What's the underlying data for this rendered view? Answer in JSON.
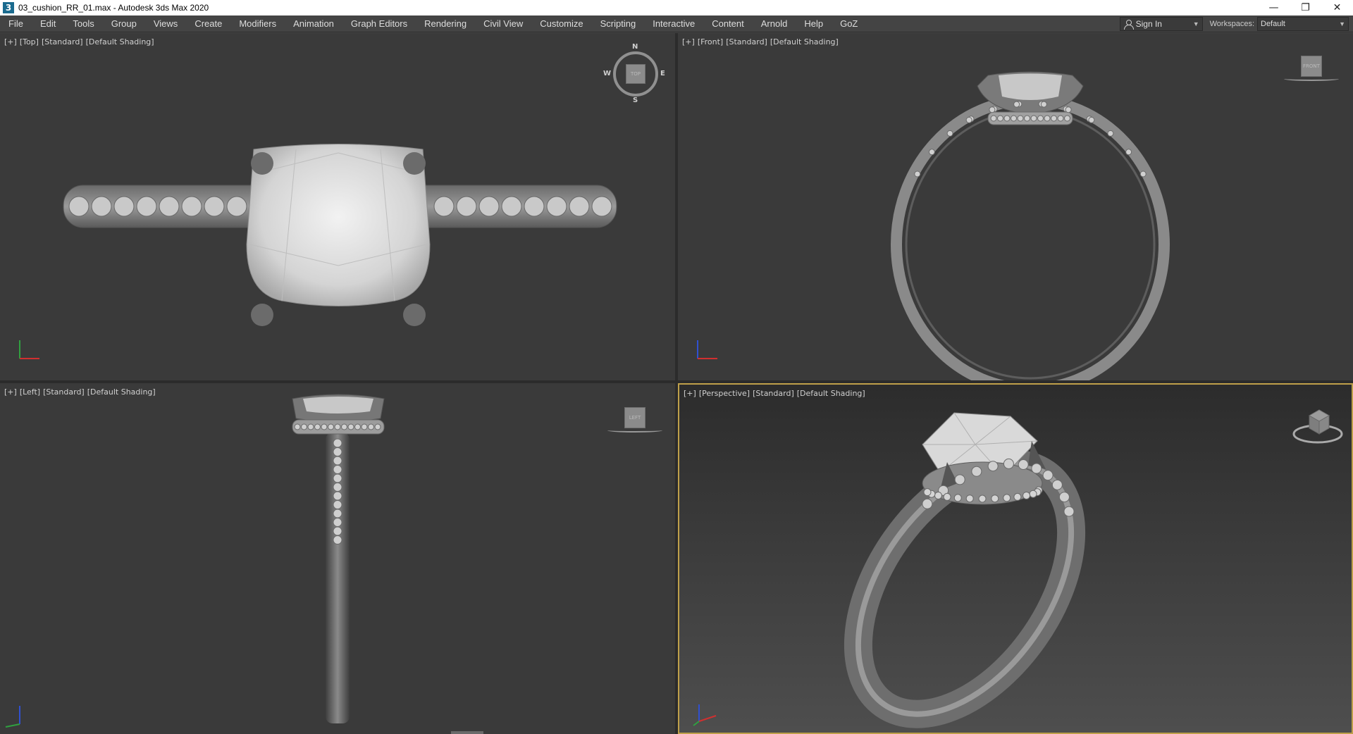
{
  "window": {
    "app_icon_letter": "3",
    "title": "03_cushion_RR_01.max - Autodesk 3ds Max 2020",
    "controls": {
      "minimize": "—",
      "restore": "❐",
      "close": "✕"
    }
  },
  "menu": {
    "items": [
      "File",
      "Edit",
      "Tools",
      "Group",
      "Views",
      "Create",
      "Modifiers",
      "Animation",
      "Graph Editors",
      "Rendering",
      "Civil View",
      "Customize",
      "Scripting",
      "Interactive",
      "Content",
      "Arnold",
      "Help",
      "GoZ"
    ],
    "sign_in": "Sign In",
    "workspaces_label": "Workspaces:",
    "workspace_value": "Default"
  },
  "viewports": {
    "top": {
      "plus": "[+]",
      "view": "[Top]",
      "style": "[Standard]",
      "shading": "[Default Shading]",
      "cube_label": "TOP",
      "compass": {
        "n": "N",
        "s": "S",
        "e": "E",
        "w": "W"
      }
    },
    "front": {
      "plus": "[+]",
      "view": "[Front]",
      "style": "[Standard]",
      "shading": "[Default Shading]",
      "cube_label": "FRONT"
    },
    "left": {
      "plus": "[+]",
      "view": "[Left]",
      "style": "[Standard]",
      "shading": "[Default Shading]",
      "cube_label": "LEFT"
    },
    "perspective": {
      "plus": "[+]",
      "view": "[Perspective]",
      "style": "[Standard]",
      "shading": "[Default Shading]"
    }
  },
  "colors": {
    "viewport_bg": "#3a3a3a",
    "active_border": "#bfa04a",
    "axis_x": "#d03030",
    "axis_y": "#30a040",
    "axis_z": "#3050d0",
    "model": "#8c8c8c"
  }
}
